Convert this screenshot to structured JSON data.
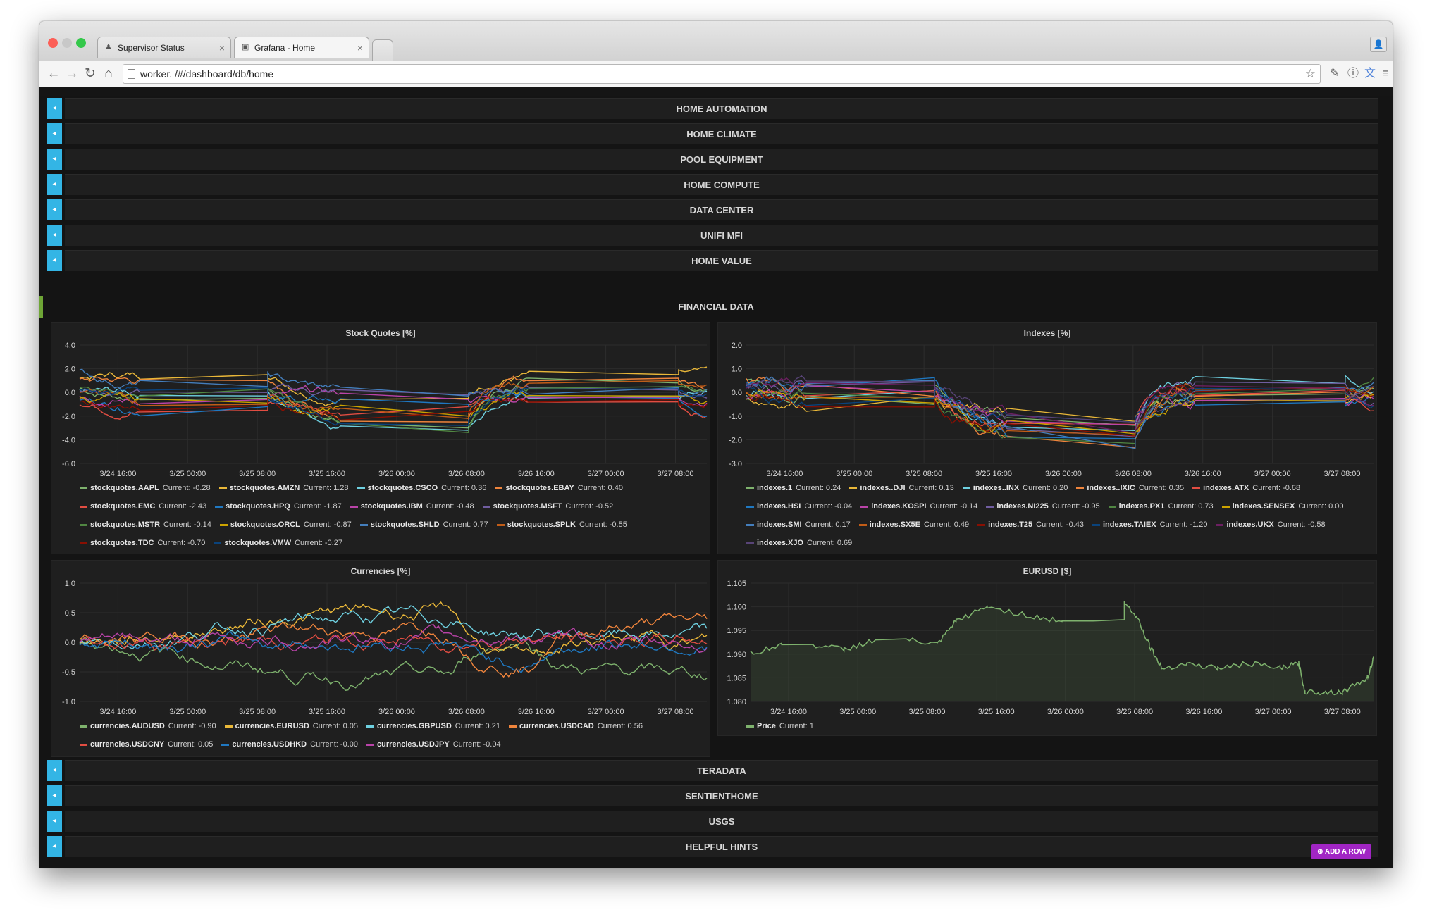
{
  "browser": {
    "tabs": [
      {
        "label": "Supervisor Status",
        "active": false
      },
      {
        "label": "Grafana - Home",
        "active": true
      }
    ],
    "url": "worker.                    /#/dashboard/db/home"
  },
  "rows_top": [
    "HOME AUTOMATION",
    "HOME CLIMATE",
    "POOL EQUIPMENT",
    "HOME COMPUTE",
    "DATA CENTER",
    "UNIFI MFI",
    "HOME VALUE"
  ],
  "financial_row_title": "FINANCIAL DATA",
  "rows_bottom": [
    "TERADATA",
    "SENTIENTHOME",
    "USGS",
    "HELPFUL HINTS"
  ],
  "add_row_label": "ADD A ROW",
  "colors": {
    "accent": "#33b5e5",
    "add_row": "#a125c4",
    "row_active": "#6ea536"
  },
  "panels": {
    "stock": {
      "title": "Stock Quotes [%]",
      "legend": [
        {
          "name": "stockquotes.AAPL",
          "value": "Current: -0.28",
          "color": "#7eb26d"
        },
        {
          "name": "stockquotes.AMZN",
          "value": "Current: 1.28",
          "color": "#eab839"
        },
        {
          "name": "stockquotes.CSCO",
          "value": "Current: 0.36",
          "color": "#6ed0e0"
        },
        {
          "name": "stockquotes.EBAY",
          "value": "Current: 0.40",
          "color": "#ef843c"
        },
        {
          "name": "stockquotes.EMC",
          "value": "Current: -2.43",
          "color": "#e24d42"
        },
        {
          "name": "stockquotes.HPQ",
          "value": "Current: -1.87",
          "color": "#1f78c1"
        },
        {
          "name": "stockquotes.IBM",
          "value": "Current: -0.48",
          "color": "#ba43a9"
        },
        {
          "name": "stockquotes.MSFT",
          "value": "Current: -0.52",
          "color": "#705da0"
        },
        {
          "name": "stockquotes.MSTR",
          "value": "Current: -0.14",
          "color": "#508642"
        },
        {
          "name": "stockquotes.ORCL",
          "value": "Current: -0.87",
          "color": "#cca300"
        },
        {
          "name": "stockquotes.SHLD",
          "value": "Current: 0.77",
          "color": "#447ebc"
        },
        {
          "name": "stockquotes.SPLK",
          "value": "Current: -0.55",
          "color": "#c15c17"
        },
        {
          "name": "stockquotes.TDC",
          "value": "Current: -0.70",
          "color": "#890f02"
        },
        {
          "name": "stockquotes.VMW",
          "value": "Current: -0.27",
          "color": "#0a437c"
        }
      ]
    },
    "indexes": {
      "title": "Indexes [%]",
      "legend": [
        {
          "name": "indexes.1",
          "value": "Current: 0.24",
          "color": "#7eb26d"
        },
        {
          "name": "indexes..DJI",
          "value": "Current: 0.13",
          "color": "#eab839"
        },
        {
          "name": "indexes..INX",
          "value": "Current: 0.20",
          "color": "#6ed0e0"
        },
        {
          "name": "indexes..IXIC",
          "value": "Current: 0.35",
          "color": "#ef843c"
        },
        {
          "name": "indexes.ATX",
          "value": "Current: -0.68",
          "color": "#e24d42"
        },
        {
          "name": "indexes.HSI",
          "value": "Current: -0.04",
          "color": "#1f78c1"
        },
        {
          "name": "indexes.KOSPI",
          "value": "Current: -0.14",
          "color": "#ba43a9"
        },
        {
          "name": "indexes.NI225",
          "value": "Current: -0.95",
          "color": "#705da0"
        },
        {
          "name": "indexes.PX1",
          "value": "Current: 0.73",
          "color": "#508642"
        },
        {
          "name": "indexes.SENSEX",
          "value": "Current: 0.00",
          "color": "#cca300"
        },
        {
          "name": "indexes.SMI",
          "value": "Current: 0.17",
          "color": "#447ebc"
        },
        {
          "name": "indexes.SX5E",
          "value": "Current: 0.49",
          "color": "#c15c17"
        },
        {
          "name": "indexes.T25",
          "value": "Current: -0.43",
          "color": "#890f02"
        },
        {
          "name": "indexes.TAIEX",
          "value": "Current: -1.20",
          "color": "#0a437c"
        },
        {
          "name": "indexes.UKX",
          "value": "Current: -0.58",
          "color": "#6d1f62"
        },
        {
          "name": "indexes.XJO",
          "value": "Current: 0.69",
          "color": "#584477"
        }
      ]
    },
    "currencies": {
      "title": "Currencies [%]",
      "legend": [
        {
          "name": "currencies.AUDUSD",
          "value": "Current: -0.90",
          "color": "#7eb26d"
        },
        {
          "name": "currencies.EURUSD",
          "value": "Current: 0.05",
          "color": "#eab839"
        },
        {
          "name": "currencies.GBPUSD",
          "value": "Current: 0.21",
          "color": "#6ed0e0"
        },
        {
          "name": "currencies.USDCAD",
          "value": "Current: 0.56",
          "color": "#ef843c"
        },
        {
          "name": "currencies.USDCNY",
          "value": "Current: 0.05",
          "color": "#e24d42"
        },
        {
          "name": "currencies.USDHKD",
          "value": "Current: -0.00",
          "color": "#1f78c1"
        },
        {
          "name": "currencies.USDJPY",
          "value": "Current: -0.04",
          "color": "#ba43a9"
        }
      ]
    },
    "eurusd": {
      "title": "EURUSD [$]",
      "legend": [
        {
          "name": "Price",
          "value": "Current: 1",
          "color": "#7eb26d"
        }
      ]
    }
  },
  "chart_data": [
    {
      "type": "line",
      "title": "Stock Quotes [%]",
      "yticks": [
        "4.0",
        "2.0",
        "0.0",
        "-2.0",
        "-4.0",
        "-6.0"
      ],
      "ylim": [
        -6,
        4
      ],
      "xticks": [
        "3/24 16:00",
        "3/25 00:00",
        "3/25 08:00",
        "3/25 16:00",
        "3/26 00:00",
        "3/26 08:00",
        "3/26 16:00",
        "3/27 00:00",
        "3/27 08:00"
      ],
      "grid": true,
      "legend_position": "bottom",
      "series_seed": [
        {
          "name": "stockquotes.AAPL",
          "start": 0.4,
          "flat": -0.5,
          "seg3": -3.0,
          "seg4": 0.8,
          "end": -0.28
        },
        {
          "name": "stockquotes.AMZN",
          "start": 1.5,
          "flat": 1.5,
          "seg3": -0.5,
          "seg4": 1.5,
          "end": 1.28
        },
        {
          "name": "stockquotes.CSCO",
          "start": 0.3,
          "flat": -0.3,
          "seg3": -3.2,
          "seg4": -0.3,
          "end": 0.36
        },
        {
          "name": "stockquotes.EBAY",
          "start": 1.0,
          "flat": 1.0,
          "seg3": -2.5,
          "seg4": 1.2,
          "end": 0.4
        },
        {
          "name": "stockquotes.EMC",
          "start": -0.8,
          "flat": -1.5,
          "seg3": -1.2,
          "seg4": -0.8,
          "end": -2.43
        },
        {
          "name": "stockquotes.HPQ",
          "start": -0.5,
          "flat": -1.2,
          "seg3": -1.0,
          "seg4": -0.5,
          "end": -1.87
        },
        {
          "name": "stockquotes.IBM",
          "start": -0.2,
          "flat": -0.6,
          "seg3": -0.6,
          "seg4": -0.4,
          "end": -0.48
        },
        {
          "name": "stockquotes.MSFT",
          "start": 0.2,
          "flat": 0.0,
          "seg3": -0.2,
          "seg4": 0.2,
          "end": -0.52
        },
        {
          "name": "stockquotes.MSTR",
          "start": 0.5,
          "flat": 0.3,
          "seg3": -3.4,
          "seg4": 0.5,
          "end": -0.14
        },
        {
          "name": "stockquotes.ORCL",
          "start": -0.3,
          "flat": -0.9,
          "seg3": -2.0,
          "seg4": -0.3,
          "end": -0.87
        },
        {
          "name": "stockquotes.SHLD",
          "start": 1.8,
          "flat": 0.5,
          "seg3": -0.3,
          "seg4": 0.4,
          "end": 0.77
        },
        {
          "name": "stockquotes.SPLK",
          "start": 0.0,
          "flat": -1.0,
          "seg3": -2.2,
          "seg4": 1.0,
          "end": -0.55
        },
        {
          "name": "stockquotes.TDC",
          "start": -0.6,
          "flat": -1.1,
          "seg3": -1.6,
          "seg4": -0.6,
          "end": -0.7
        },
        {
          "name": "stockquotes.VMW",
          "start": 0.1,
          "flat": 0.4,
          "seg3": -2.8,
          "seg4": 0.3,
          "end": -0.27
        }
      ]
    },
    {
      "type": "line",
      "title": "Indexes [%]",
      "yticks": [
        "2.0",
        "1.0",
        "0.0",
        "-1.0",
        "-2.0",
        "-3.0"
      ],
      "ylim": [
        -3,
        2
      ],
      "xticks": [
        "3/24 16:00",
        "3/25 00:00",
        "3/25 08:00",
        "3/25 16:00",
        "3/26 00:00",
        "3/26 08:00",
        "3/26 16:00",
        "3/27 00:00",
        "3/27 08:00"
      ],
      "grid": true,
      "legend_position": "bottom"
    },
    {
      "type": "line",
      "title": "Currencies [%]",
      "yticks": [
        "1.0",
        "0.5",
        "0.0",
        "-0.5",
        "-1.0"
      ],
      "ylim": [
        -1,
        1
      ],
      "xticks": [
        "3/24 16:00",
        "3/25 00:00",
        "3/25 08:00",
        "3/25 16:00",
        "3/26 00:00",
        "3/26 08:00",
        "3/26 16:00",
        "3/27 00:00",
        "3/27 08:00"
      ],
      "grid": true,
      "legend_position": "bottom"
    },
    {
      "type": "area",
      "title": "EURUSD [$]",
      "yticks": [
        "1.105",
        "1.100",
        "1.095",
        "1.090",
        "1.085",
        "1.080"
      ],
      "ylim": [
        1.08,
        1.105
      ],
      "xticks": [
        "3/24 16:00",
        "3/25 00:00",
        "3/25 08:00",
        "3/25 16:00",
        "3/26 00:00",
        "3/26 08:00",
        "3/26 16:00",
        "3/27 00:00",
        "3/27 08:00"
      ],
      "grid": true,
      "legend_position": "bottom",
      "x": [
        0,
        0.05,
        0.1,
        0.15,
        0.2,
        0.25,
        0.3,
        0.33,
        0.38,
        0.45,
        0.5,
        0.55,
        0.6,
        0.6,
        0.62,
        0.64,
        0.66,
        0.7,
        0.75,
        0.8,
        0.85,
        0.88,
        0.89,
        0.92,
        0.95,
        0.99,
        1.0
      ],
      "values": [
        1.09,
        1.092,
        1.092,
        1.091,
        1.093,
        1.093,
        1.092,
        1.097,
        1.1,
        1.098,
        1.097,
        1.097,
        1.097,
        1.101,
        1.098,
        1.092,
        1.087,
        1.088,
        1.087,
        1.088,
        1.087,
        1.088,
        1.082,
        1.082,
        1.082,
        1.085,
        1.089
      ]
    }
  ]
}
